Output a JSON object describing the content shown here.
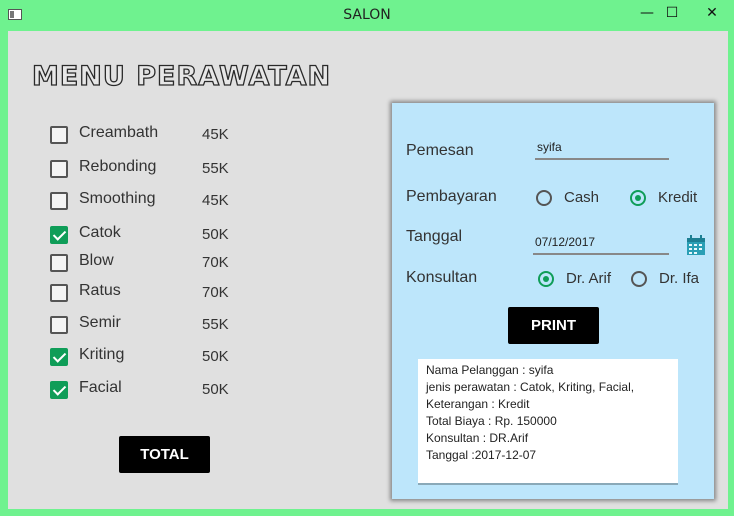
{
  "window": {
    "title": "SALON",
    "minimize": "—",
    "maximize": "☐",
    "close": "✕"
  },
  "heading": "MENU PERAWATAN",
  "menu_items": [
    {
      "name": "Creambath",
      "price": "45K",
      "checked": false
    },
    {
      "name": "Rebonding",
      "price": "55K",
      "checked": false
    },
    {
      "name": "Smoothing",
      "price": "45K",
      "checked": false
    },
    {
      "name": "Catok",
      "price": "50K",
      "checked": true
    },
    {
      "name": "Blow",
      "price": "70K",
      "checked": false
    },
    {
      "name": "Ratus",
      "price": "70K",
      "checked": false
    },
    {
      "name": "Semir",
      "price": "55K",
      "checked": false
    },
    {
      "name": "Kriting",
      "price": "50K",
      "checked": true
    },
    {
      "name": "Facial",
      "price": "50K",
      "checked": true
    }
  ],
  "total_button": "TOTAL",
  "form": {
    "pemesan_label": "Pemesan",
    "pemesan_value": "syifa",
    "pembayaran_label": "Pembayaran",
    "payment_options": [
      {
        "label": "Cash",
        "selected": false
      },
      {
        "label": "Kredit",
        "selected": true
      }
    ],
    "tanggal_label": "Tanggal",
    "tanggal_value": "07/12/2017",
    "konsultan_label": "Konsultan",
    "konsultan_options": [
      {
        "label": "Dr. Arif",
        "selected": true
      },
      {
        "label": "Dr. Ifa",
        "selected": false
      }
    ],
    "print_button": "PRINT"
  },
  "output_lines": [
    "Nama Pelanggan : syifa",
    "jenis perawatan : Catok, Kriting, Facial,",
    "Keterangan : Kredit",
    "Total Biaya : Rp. 150000",
    "Konsultan : DR.Arif",
    "Tanggal :2017-12-07"
  ],
  "colors": {
    "window_frame": "#6ff28f",
    "panel": "#bde6fb",
    "accent": "#0f9d58"
  }
}
